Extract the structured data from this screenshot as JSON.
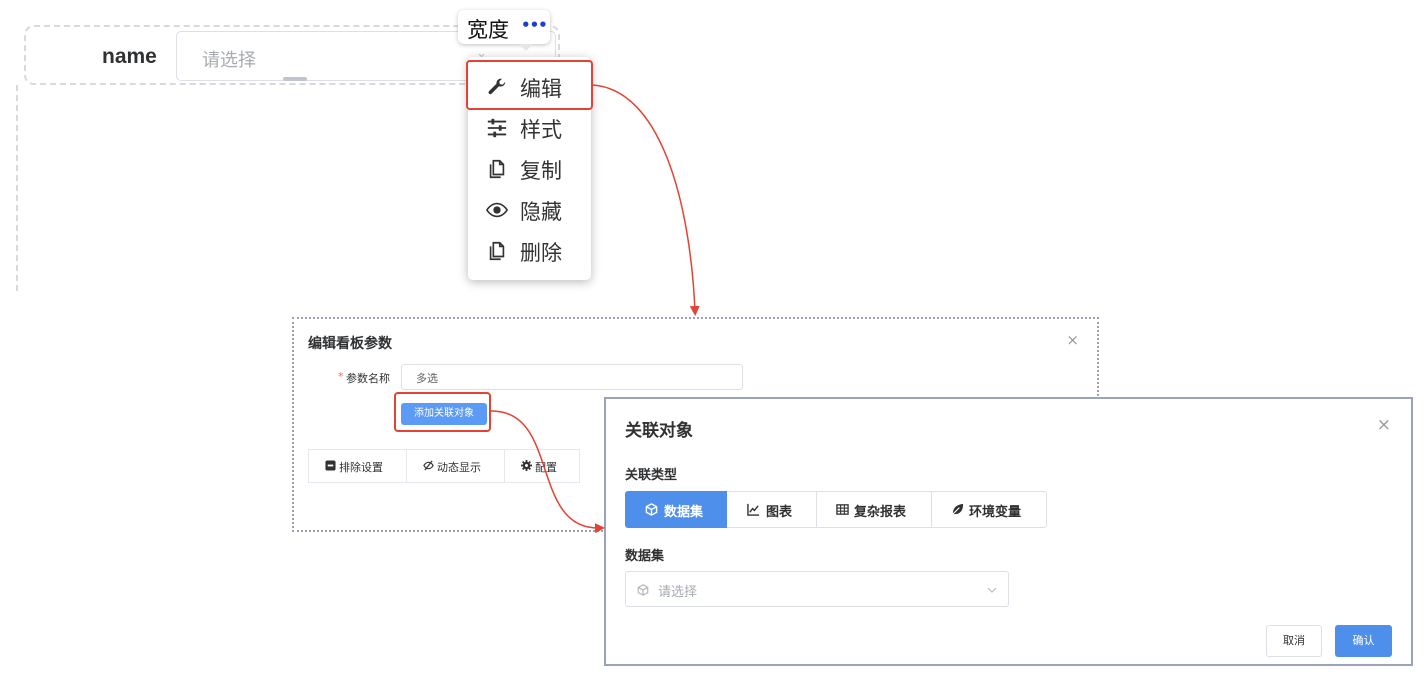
{
  "form": {
    "label": "name",
    "select_placeholder": "请选择",
    "width_chip": {
      "label": "宽度",
      "more": "•••"
    }
  },
  "context_menu": {
    "items": [
      {
        "label": "编辑",
        "icon": "wrench-icon"
      },
      {
        "label": "样式",
        "icon": "sliders-icon"
      },
      {
        "label": "复制",
        "icon": "copy-icon"
      },
      {
        "label": "隐藏",
        "icon": "eye-icon"
      },
      {
        "label": "删除",
        "icon": "copy-icon"
      }
    ],
    "highlighted": "编辑"
  },
  "edit_dialog": {
    "title": "编辑看板参数",
    "close": "×",
    "required_mark": "*",
    "param_name_label": "参数名称",
    "param_name_value": "多选",
    "add_button": "添加关联对象",
    "tabs": [
      {
        "label": "排除设置",
        "icon": "minus-square-icon"
      },
      {
        "label": "动态显示",
        "icon": "eye-off-icon"
      },
      {
        "label": "配置",
        "icon": "gear-icon"
      }
    ]
  },
  "relate_dialog": {
    "title": "关联对象",
    "close": "×",
    "type_label": "关联类型",
    "types": [
      {
        "label": "数据集",
        "icon": "cube-icon",
        "active": true
      },
      {
        "label": "图表",
        "icon": "line-chart-icon",
        "active": false
      },
      {
        "label": "复杂报表",
        "icon": "table-icon",
        "active": false
      },
      {
        "label": "环境变量",
        "icon": "leaf-icon",
        "active": false
      }
    ],
    "dataset_label": "数据集",
    "dataset_placeholder": "请选择",
    "cancel_label": "取消",
    "confirm_label": "确认"
  },
  "colors": {
    "primary": "#4d8fea",
    "highlight": "#e34234",
    "border": "#dcdfe6"
  }
}
